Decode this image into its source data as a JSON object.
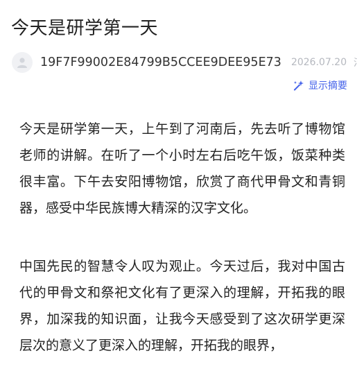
{
  "article": {
    "title": "今天是研学第一天"
  },
  "meta": {
    "author": "19F7F99002E84799B5CCEE9DEE95E73",
    "date": "2026.07.20",
    "region": "河南"
  },
  "actions": {
    "summary_label": "显示摘要",
    "summary_icon": "ai-sparkle-icon",
    "accent_color": "#4462ea"
  },
  "content": {
    "paragraphs": [
      "今天是研学第一天，上午到了河南后，先去听了博物馆老师的讲解。在听了一个小时左右后吃午饭，饭菜种类很丰富。下午去安阳博物馆，欣赏了商代甲骨文和青铜器，感受中华民族博大精深的汉字文化。",
      "中国先民的智慧令人叹为观止。今天过后，我对中国古代的甲骨文和祭祀文化有了更深入的理解，开拓我的眼界，加深我的知识面，让我今天感受到了这次研学更深层次的意义了更深入的理解，开拓我的眼界，"
    ]
  }
}
